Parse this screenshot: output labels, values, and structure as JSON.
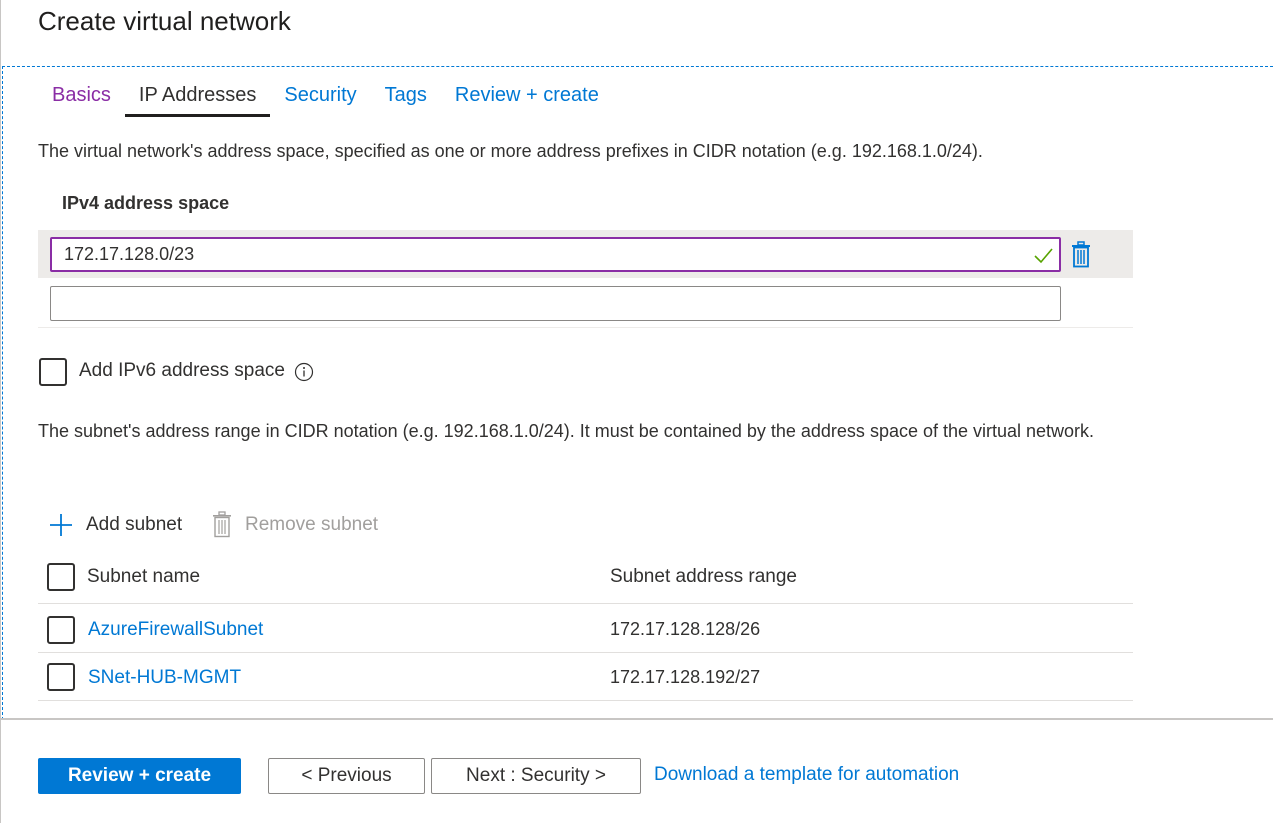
{
  "page": {
    "title": "Create virtual network"
  },
  "tabs": [
    {
      "label": "Basics",
      "state": "visited"
    },
    {
      "label": "IP Addresses",
      "state": "active"
    },
    {
      "label": "Security",
      "state": "default"
    },
    {
      "label": "Tags",
      "state": "default"
    },
    {
      "label": "Review + create",
      "state": "default"
    }
  ],
  "address_space": {
    "description": "The virtual network's address space, specified as one or more address prefixes in CIDR notation (e.g. 192.168.1.0/24).",
    "ipv4_label": "IPv4 address space",
    "entries": [
      "172.17.128.0/23"
    ],
    "new_entry_value": "",
    "add_ipv6_label": "Add IPv6 address space",
    "add_ipv6_checked": false
  },
  "subnets": {
    "description": "The subnet's address range in CIDR notation (e.g. 192.168.1.0/24). It must be contained by the address space of the virtual network.",
    "add_label": "Add subnet",
    "remove_label": "Remove subnet",
    "columns": [
      "Subnet name",
      "Subnet address range"
    ],
    "rows": [
      {
        "name": "AzureFirewallSubnet",
        "range": "172.17.128.128/26"
      },
      {
        "name": "SNet-HUB-MGMT",
        "range": "172.17.128.192/27"
      }
    ]
  },
  "footer": {
    "review_create": "Review + create",
    "previous": "< Previous",
    "next": "Next : Security >",
    "download_link": "Download a template for automation"
  },
  "colors": {
    "accent": "#0078d4",
    "visited": "#8a2da5",
    "valid": "#57a300"
  }
}
